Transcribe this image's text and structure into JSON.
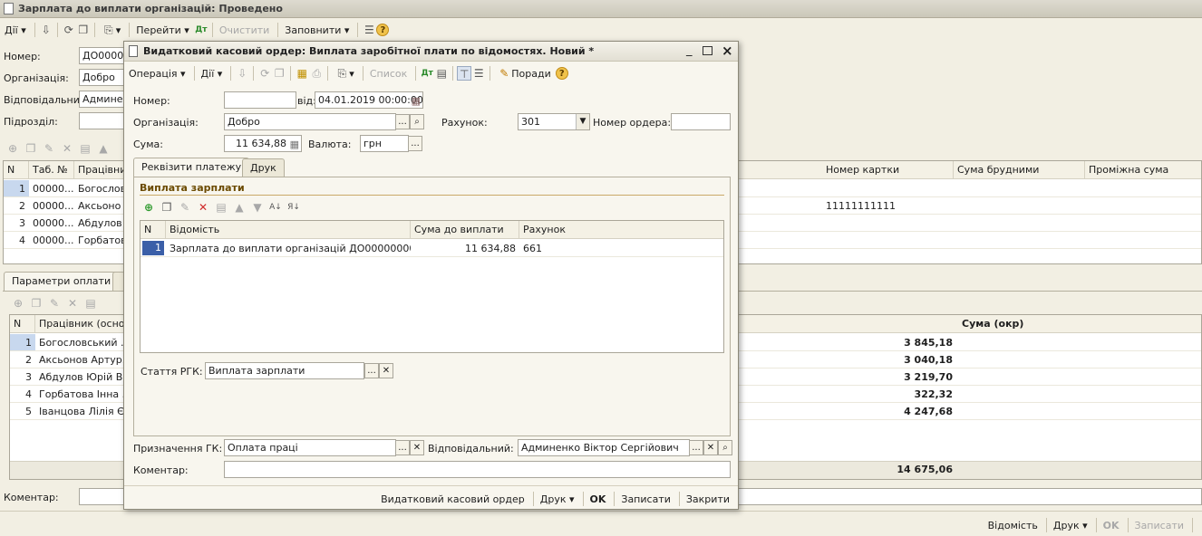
{
  "main": {
    "title": "Зарплата до виплати організацій: Проведено",
    "toolbar": {
      "actions": "Дії",
      "go": "Перейти",
      "clear": "Очистити",
      "fill": "Заповнити"
    },
    "fields": {
      "number_label": "Номер:",
      "number_value": "ДО00000",
      "org_label": "Організація:",
      "org_value": "Добро",
      "resp_label": "Відповідальний:",
      "resp_value": "Админен",
      "dept_label": "Підрозділ:",
      "dept_value": ""
    },
    "table1": {
      "headers": {
        "n": "N",
        "tab": "Таб. №",
        "worker": "Працівник",
        "card": "Номер картки",
        "gross": "Сума брудними",
        "interim": "Проміжна сума"
      },
      "rows": [
        {
          "n": "1",
          "tab": "00000...",
          "worker": "Богослов",
          "card": ""
        },
        {
          "n": "2",
          "tab": "00000...",
          "worker": "Аксьоно",
          "card": "11111111111"
        },
        {
          "n": "3",
          "tab": "00000...",
          "worker": "Абдулов Ю",
          "card": ""
        },
        {
          "n": "4",
          "tab": "00000...",
          "worker": "Горбатов",
          "card": ""
        }
      ]
    },
    "params_tab": "Параметри оплати",
    "table2": {
      "headers": {
        "n": "N",
        "worker": "Працівник (осно...",
        "sum": "Сума (окр)"
      },
      "rows": [
        {
          "n": "1",
          "worker": "Богословський ...",
          "value": "3 845,18"
        },
        {
          "n": "2",
          "worker": "Аксьонов Артур...",
          "value": "3 040,18"
        },
        {
          "n": "3",
          "worker": "Абдулов Юрій В...",
          "value": "3 219,70"
        },
        {
          "n": "4",
          "worker": "Горбатова Інна ...",
          "value": "322,32"
        },
        {
          "n": "5",
          "worker": "Іванцова Лілія Є...",
          "value": "4 247,68"
        }
      ],
      "total": "14 675,06"
    },
    "comment_label": "Коментар:",
    "bottom": {
      "statement": "Відомість",
      "print": "Друк",
      "ok": "OK",
      "save": "Записати"
    }
  },
  "dialog": {
    "title": "Видатковий касовий ордер: Виплата заробітної плати по відомостях. Новий *",
    "toolbar": {
      "operation": "Операція",
      "actions": "Дії",
      "list": "Список",
      "tips": "Поради"
    },
    "number_label": "Номер:",
    "number_value": "",
    "date_label": "від:",
    "date_value": "04.01.2019 00:00:00",
    "org_label": "Організація:",
    "org_value": "Добро",
    "account_label": "Рахунок:",
    "account_value": "301",
    "order_label": "Номер ордера:",
    "order_value": "",
    "sum_label": "Сума:",
    "sum_value": "11 634,88",
    "currency_label": "Валюта:",
    "currency_value": "грн",
    "tabs": {
      "details": "Реквізити платежу",
      "print": "Друк"
    },
    "section_title": "Виплата зарплати",
    "grid": {
      "headers": {
        "n": "N",
        "statement": "Відомість",
        "amount": "Сума до виплати",
        "account": "Рахунок"
      },
      "rows": [
        {
          "n": "1",
          "statement": "Зарплата до виплати організацій ДО000000001 о...",
          "amount": "11 634,88",
          "account": "661"
        }
      ]
    },
    "rgk_label": "Стаття РГК:",
    "rgk_value": "Виплата зарплати",
    "purpose_label": "Призначення ГК:",
    "purpose_value": "Оплата праці",
    "resp_label": "Відповідальний:",
    "resp_value": "Админенко Віктор Сергійович",
    "comment_label": "Коментар:",
    "comment_value": "",
    "footer": {
      "order": "Видатковий касовий ордер",
      "print": "Друк",
      "ok": "OK",
      "save": "Записати",
      "close": "Закрити"
    }
  }
}
